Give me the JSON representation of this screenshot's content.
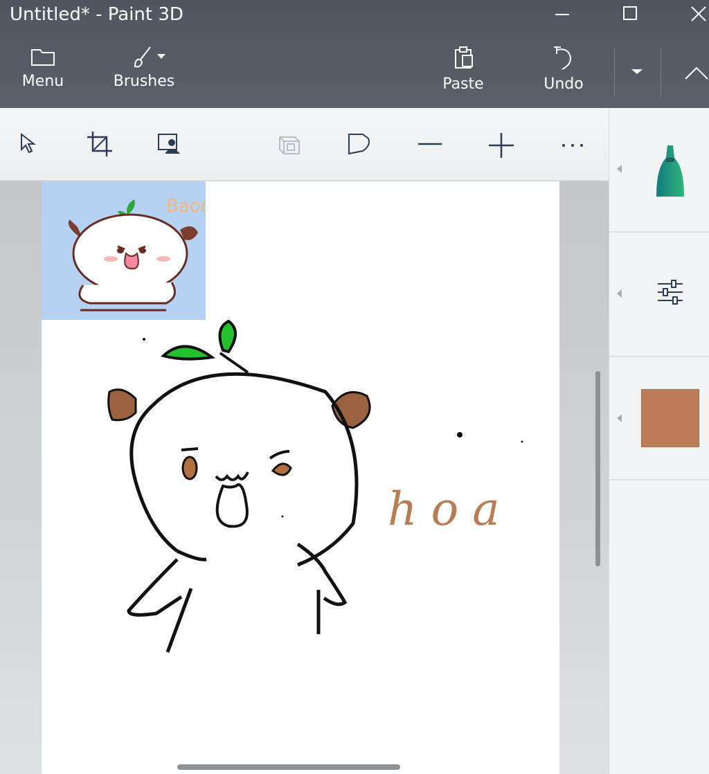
{
  "window": {
    "title": "Untitled* - Paint 3D"
  },
  "commands": {
    "menu_label": "Menu",
    "brushes_label": "Brushes",
    "paste_label": "Paste",
    "undo_label": "Undo"
  },
  "toolbar": {
    "tools": [
      "select-icon",
      "crop-icon",
      "magic-select-icon",
      "view-3d-icon",
      "sticker-shape-icon",
      "zoom-out-icon",
      "zoom-in-icon",
      "more-icon"
    ]
  },
  "canvas": {
    "handwriting_text": "hoa",
    "sticker_caption": "Baoo",
    "brush_color": "#b87d55",
    "outline_color": "#111111",
    "leaf_color": "#22c22e",
    "ear_color": "#9b6240"
  },
  "panel": {
    "selected_color": "#b97c56",
    "marker_color": "#1f9d7a"
  }
}
